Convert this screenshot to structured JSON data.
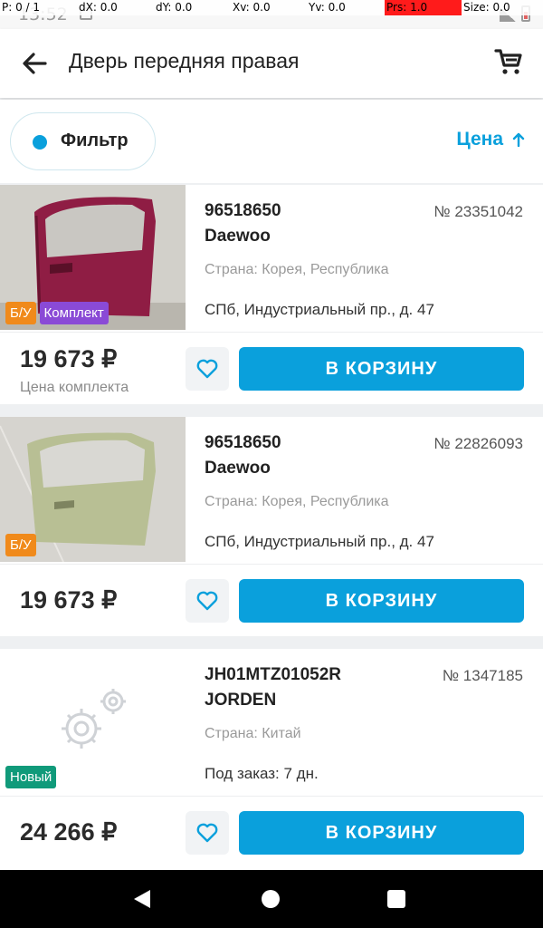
{
  "debug_overlay": {
    "p": "P: 0 / 1",
    "dx": "dX: 0.0",
    "dy": "dY: 0.0",
    "xv": "Xv: 0.0",
    "yv": "Yv: 0.0",
    "prs": "Prs: 1.0",
    "size": "Size: 0.0"
  },
  "status_bar": {
    "time": "13:52"
  },
  "header": {
    "title": "Дверь передняя правая",
    "back_icon": "arrow-left-icon",
    "cart_icon": "cart-icon"
  },
  "filter_bar": {
    "filter_label": "Фильтр",
    "sort_label": "Цена",
    "sort_icon": "arrow-up-icon",
    "accent": "#0aa0dc"
  },
  "products": [
    {
      "part_number": "96518650",
      "brand": "Daewoo",
      "lot": "№ 23351042",
      "country": "Страна: Корея, Республика",
      "location": "СПб, Индустриальный пр., д. 47",
      "badges": [
        "Б/У",
        "Комплект"
      ],
      "price": "19 673 ₽",
      "price_note": "Цена комплекта",
      "add_label": "В КОРЗИНУ"
    },
    {
      "part_number": "96518650",
      "brand": "Daewoo",
      "lot": "№ 22826093",
      "country": "Страна: Корея, Республика",
      "location": "СПб, Индустриальный пр., д. 47",
      "badges": [
        "Б/У"
      ],
      "price": "19 673 ₽",
      "add_label": "В КОРЗИНУ"
    },
    {
      "part_number": "JH01MTZ01052R",
      "brand": "JORDEN",
      "lot": "№ 1347185",
      "country": "Страна: Китай",
      "location": "Под заказ: 7 дн.",
      "badges": [
        "Новый"
      ],
      "price": "24 266 ₽",
      "add_label": "В КОРЗИНУ"
    }
  ]
}
